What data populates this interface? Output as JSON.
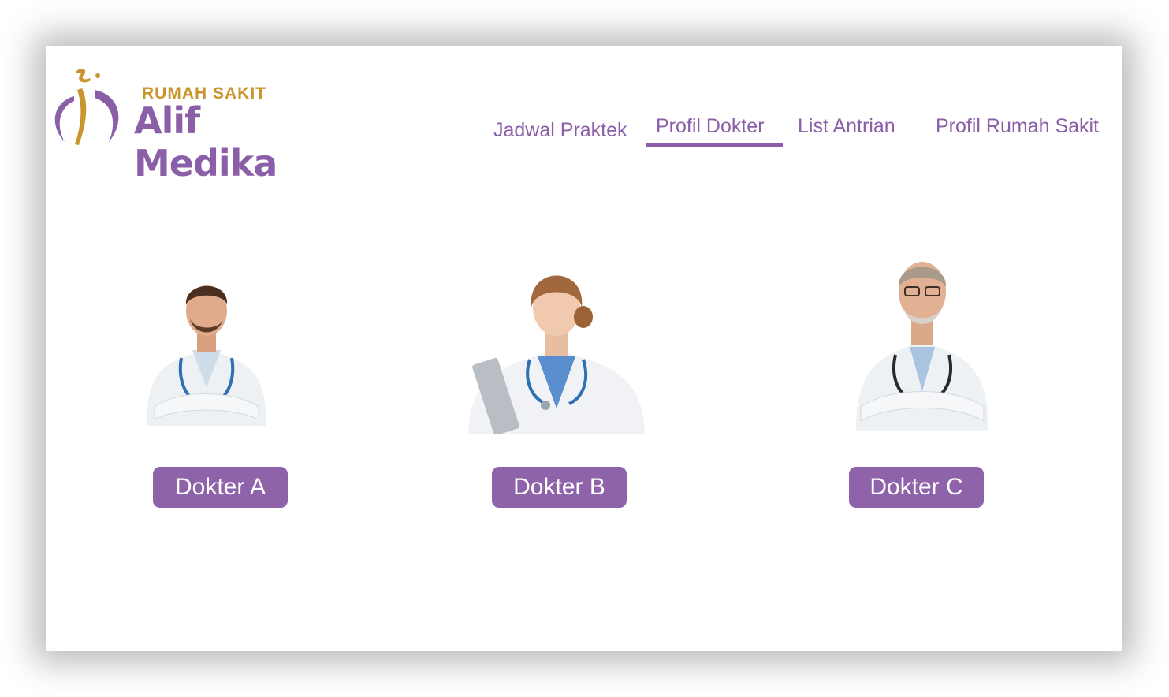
{
  "brand": {
    "subtitle": "RUMAH SAKIT",
    "name": "Alif Medika",
    "primary_color": "#8b5fa8",
    "gold_color": "#c9962e"
  },
  "nav": {
    "items": [
      {
        "label": "Jadwal Praktek"
      },
      {
        "label": "Profil Dokter",
        "active": true
      },
      {
        "label": "List Antrian"
      },
      {
        "label": "Profil Rumah Sakit"
      }
    ]
  },
  "doctors": [
    {
      "name": "Dokter A",
      "photo": "doctor-photo-young-man"
    },
    {
      "name": "Dokter B",
      "photo": "doctor-photo-woman"
    },
    {
      "name": "Dokter C",
      "photo": "doctor-photo-senior-man"
    }
  ]
}
